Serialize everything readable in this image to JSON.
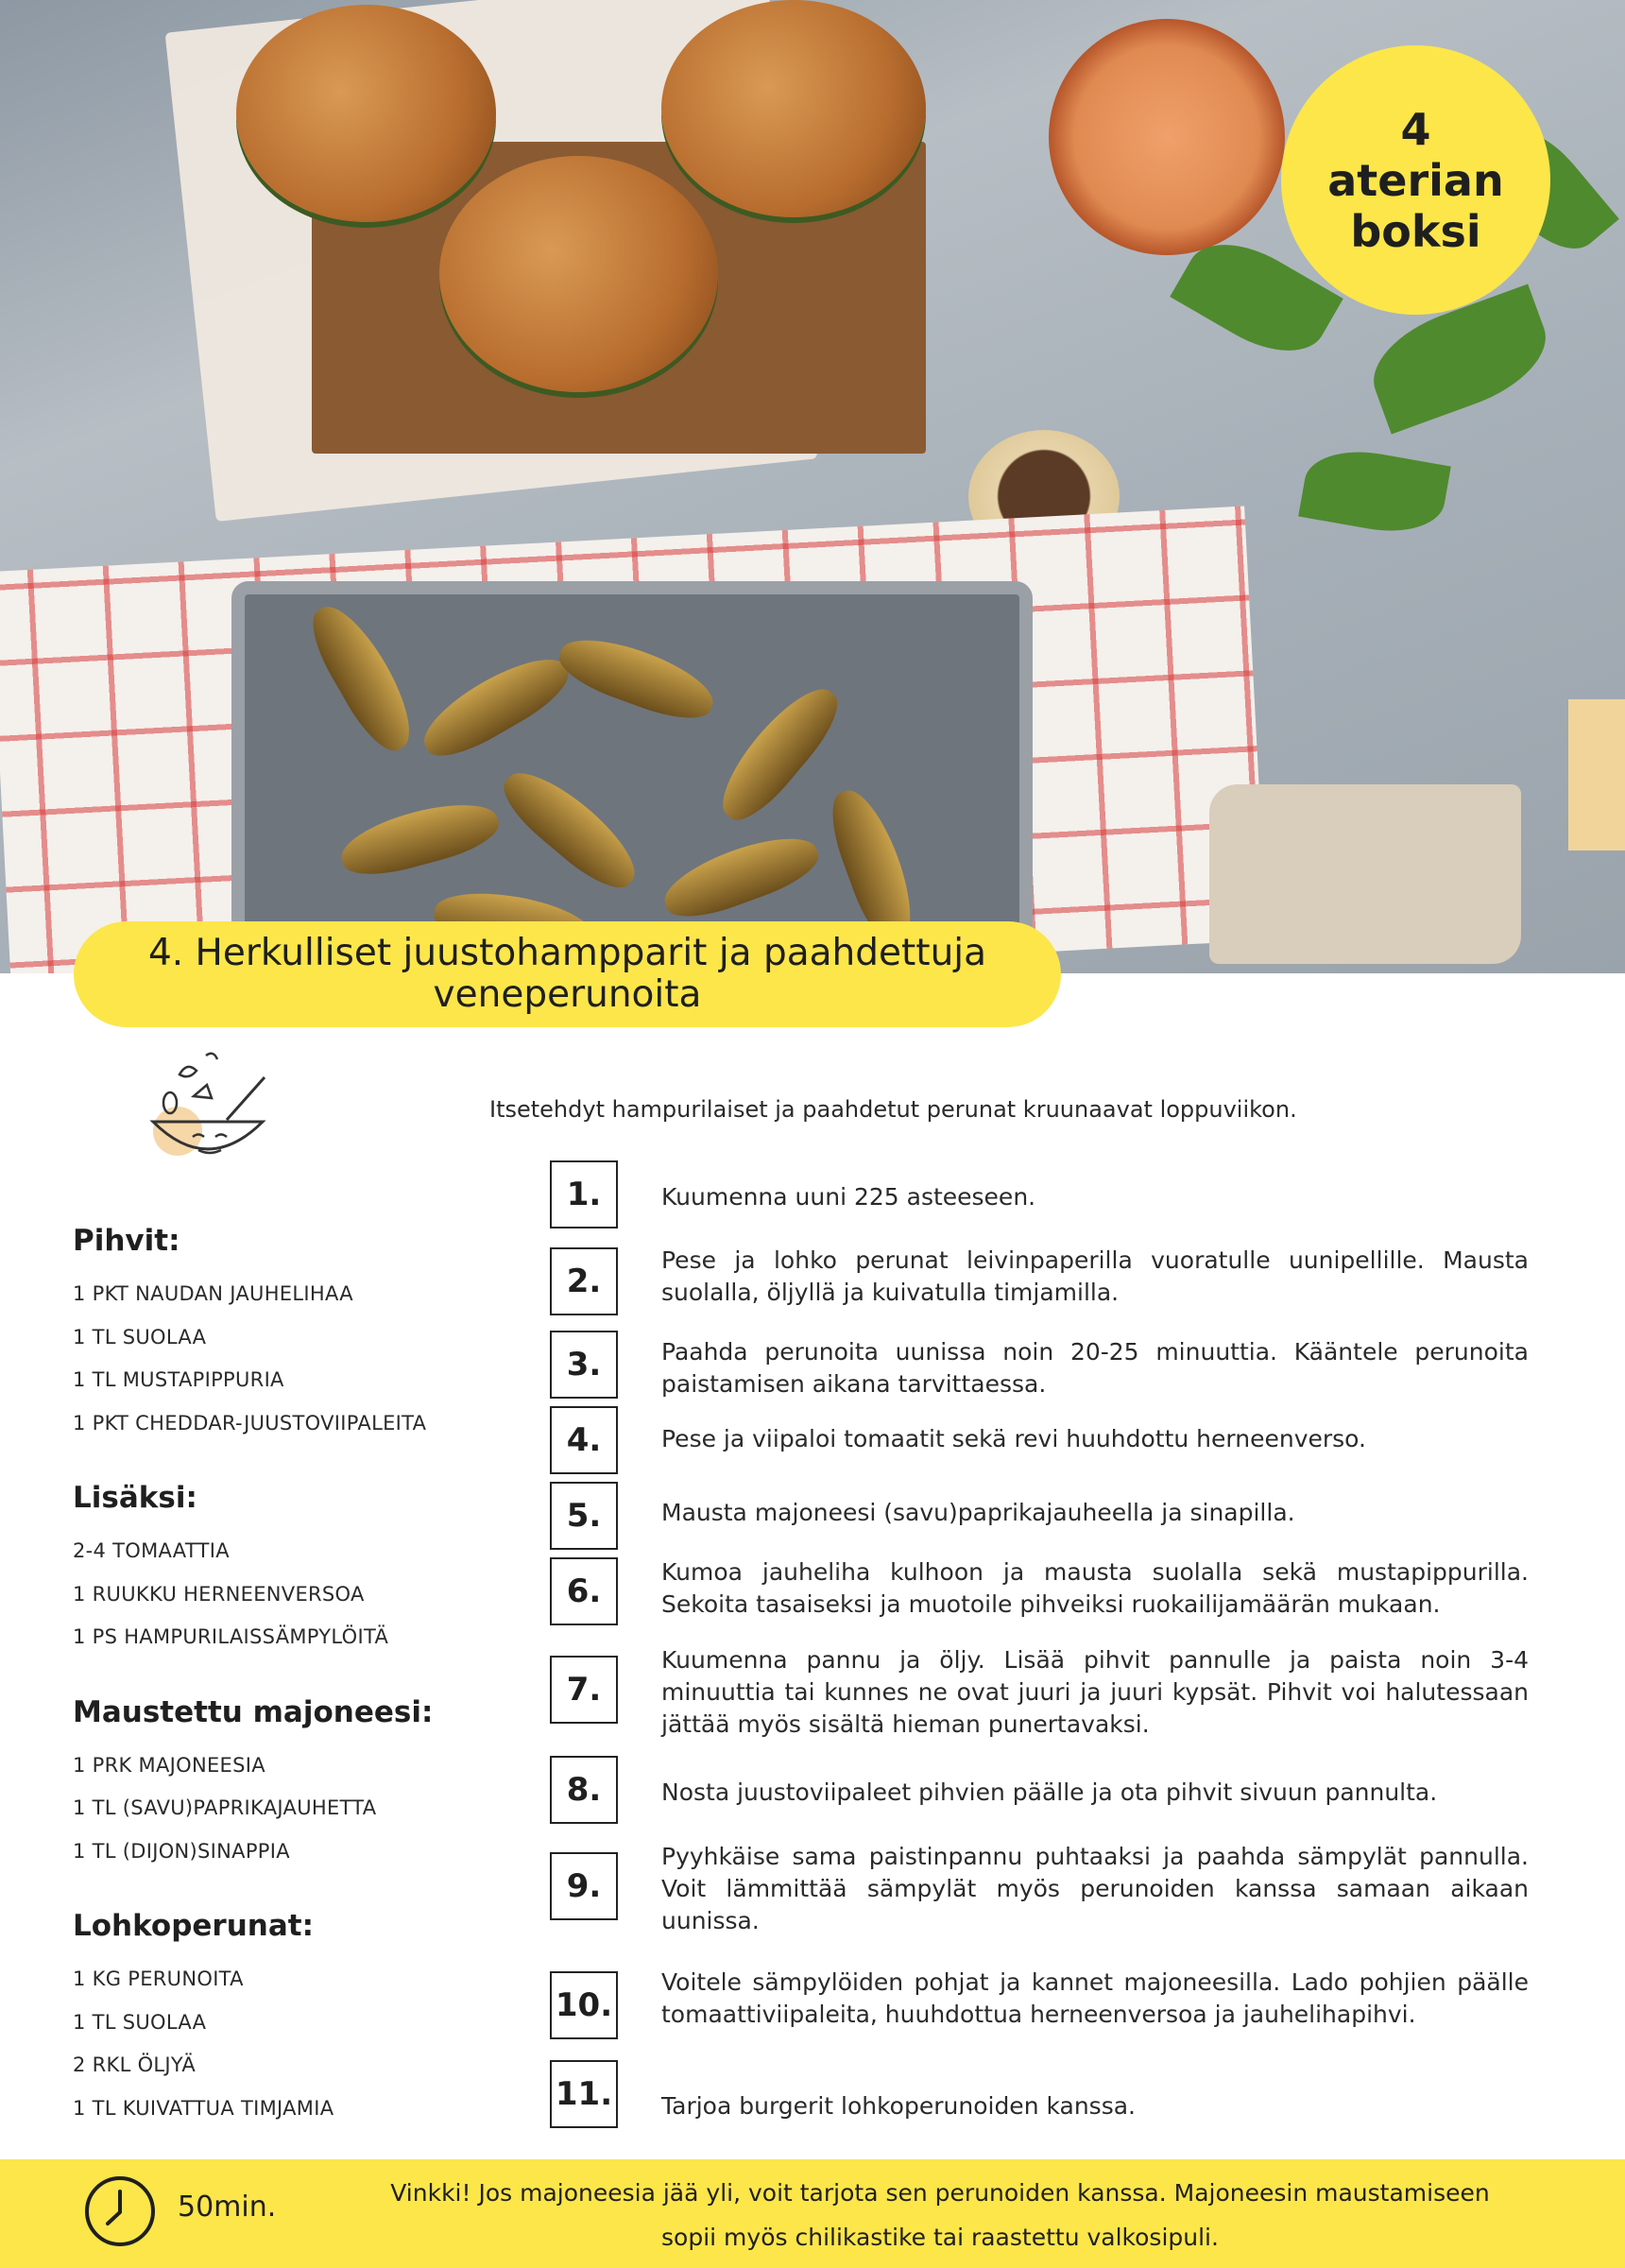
{
  "badge": {
    "line1": "4",
    "line2": "aterian",
    "line3": "boksi"
  },
  "title": {
    "line1": "4. Herkulliset juustohampparit ja paahdettuja",
    "line2": "veneperunoita"
  },
  "intro": "Itsetehdyt hampurilaiset ja paahdetut perunat kruunaavat loppuviikon.",
  "ingredients": [
    {
      "heading": "Pihvit:",
      "items": [
        "1 PKT NAUDAN JAUHELIHAA",
        "1 TL SUOLAA",
        "1 TL MUSTAPIPPURIA",
        "1 PKT CHEDDAR-JUUSTOVIIPALEITA"
      ]
    },
    {
      "heading": "Lisäksi:",
      "items": [
        "2-4 TOMAATTIA",
        "1 RUUKKU HERNEENVERSOA",
        "1 PS HAMPURILAISSÄMPYLÖITÄ"
      ]
    },
    {
      "heading": "Maustettu majoneesi:",
      "items": [
        "1 PRK MAJONEESIA",
        "1 TL (SAVU)PAPRIKAJAUHETTA",
        "1 TL (DIJON)SINAPPIA"
      ]
    },
    {
      "heading": "Lohkoperunat:",
      "items": [
        "1 KG PERUNOITA",
        "1 TL SUOLAA",
        "2 RKL ÖLJYÄ",
        "1 TL KUIVATTUA TIMJAMIA"
      ]
    }
  ],
  "steps": [
    {
      "num": "1.",
      "text": "Kuumenna uuni 225 asteeseen."
    },
    {
      "num": "2.",
      "text": "Pese ja lohko perunat leivinpaperilla vuoratulle uunipellille. Mausta suolalla, öljyllä ja kuivatulla timjamilla."
    },
    {
      "num": "3.",
      "text": "Paahda perunoita uunissa noin 20-25 minuuttia. Kääntele perunoita paistamisen aikana tarvittaessa."
    },
    {
      "num": "4.",
      "text": "Pese ja viipaloi tomaatit sekä revi huuhdottu herneenverso."
    },
    {
      "num": "5.",
      "text": "Mausta majoneesi (savu)paprikajauheella ja sinapilla."
    },
    {
      "num": "6.",
      "text": "Kumoa jauheliha kulhoon ja mausta suolalla sekä mustapippurilla. Sekoita tasaiseksi ja muotoile pihveiksi ruokailijamäärän mukaan."
    },
    {
      "num": "7.",
      "text": "Kuumenna pannu ja öljy. Lisää pihvit pannulle ja paista noin 3-4 minuuttia tai kunnes ne ovat juuri ja juuri kypsät. Pihvit voi halutessaan jättää myös sisältä hieman punertavaksi."
    },
    {
      "num": "8.",
      "text": "Nosta juustoviipaleet pihvien päälle ja ota pihvit sivuun pannulta."
    },
    {
      "num": "9.",
      "text": "Pyyhkäise sama paistinpannu puhtaaksi ja paahda sämpylät pannulla. Voit lämmittää sämpylät myös perunoiden kanssa samaan aikaan uunissa."
    },
    {
      "num": "10.",
      "text": "Voitele sämpylöiden pohjat ja kannet majoneesilla. Lado pohjien päälle tomaattiviipaleita, huuhdottua herneenversoa ja jauhelihapihvi."
    },
    {
      "num": "11.",
      "text": "Tarjoa burgerit lohkoperunoiden kanssa."
    }
  ],
  "footer": {
    "time": "50min.",
    "tip_line1": "Vinkki! Jos majoneesia jää yli, voit tarjota sen perunoiden kanssa. Majoneesin maustamiseen",
    "tip_line2": "sopii myös chilikastike tai raastettu valkosipuli."
  },
  "colors": {
    "accent_yellow": "#fce64a",
    "text": "#222222"
  }
}
